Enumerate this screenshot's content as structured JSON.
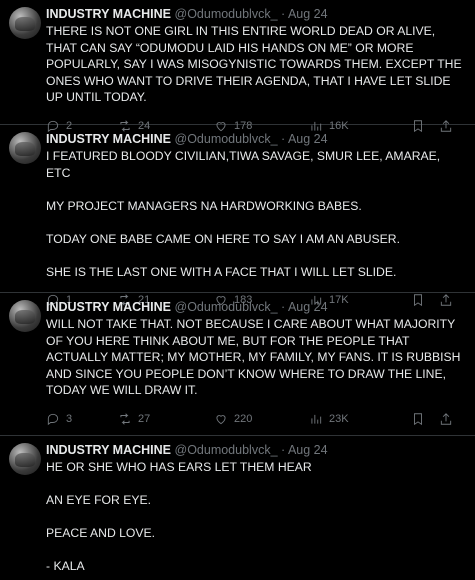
{
  "tweets": [
    {
      "name": "INDUSTRY MACHINE",
      "handle": "@Odumodublvck_",
      "dot": "·",
      "date": "Aug 24",
      "text": "THERE IS NOT ONE GIRL IN THIS ENTIRE WORLD DEAD OR ALIVE, THAT CAN SAY “ODUMODU LAID HIS HANDS ON ME” OR MORE POPULARLY, SAY I WAS MISOGYNISTIC TOWARDS THEM. EXCEPT  THE ONES WHO WANT TO DRIVE THEIR AGENDA, THAT I HAVE LET SLIDE UP UNTIL TODAY.",
      "replies": "2",
      "reposts": "24",
      "likes": "178",
      "views": "16K"
    },
    {
      "name": "INDUSTRY MACHINE",
      "handle": "@Odumodublvck_",
      "dot": "·",
      "date": "Aug 24",
      "text": "I FEATURED BLOODY CIVILIAN,TIWA SAVAGE, SMUR LEE, AMARAE, ETC\n\nMY PROJECT MANAGERS NA HARDWORKING BABES.\n\nTODAY ONE BABE CAME ON HERE TO SAY I AM AN ABUSER.\n\nSHE IS THE LAST ONE WITH A FACE THAT I WILL LET SLIDE.",
      "replies": "1",
      "reposts": "21",
      "likes": "183",
      "views": "17K"
    },
    {
      "name": "INDUSTRY MACHINE",
      "handle": "@Odumodublvck_",
      "dot": "·",
      "date": "Aug 24",
      "text": "WILL NOT TAKE THAT. NOT BECAUSE I CARE ABOUT WHAT MAJORITY OF YOU HERE THINK ABOUT ME, BUT FOR THE PEOPLE THAT ACTUALLY MATTER; MY MOTHER, MY FAMILY, MY FANS. IT IS RUBBISH AND SINCE YOU PEOPLE DON’T KNOW WHERE TO DRAW THE LINE, TODAY WE WILL DRAW IT.",
      "replies": "3",
      "reposts": "27",
      "likes": "220",
      "views": "23K"
    },
    {
      "name": "INDUSTRY MACHINE",
      "handle": "@Odumodublvck_",
      "dot": "·",
      "date": "Aug 24",
      "text": "HE OR SHE WHO HAS EARS LET THEM HEAR\n\nAN EYE FOR EYE.\n\nPEACE AND LOVE.\n\n- KALA"
    }
  ]
}
